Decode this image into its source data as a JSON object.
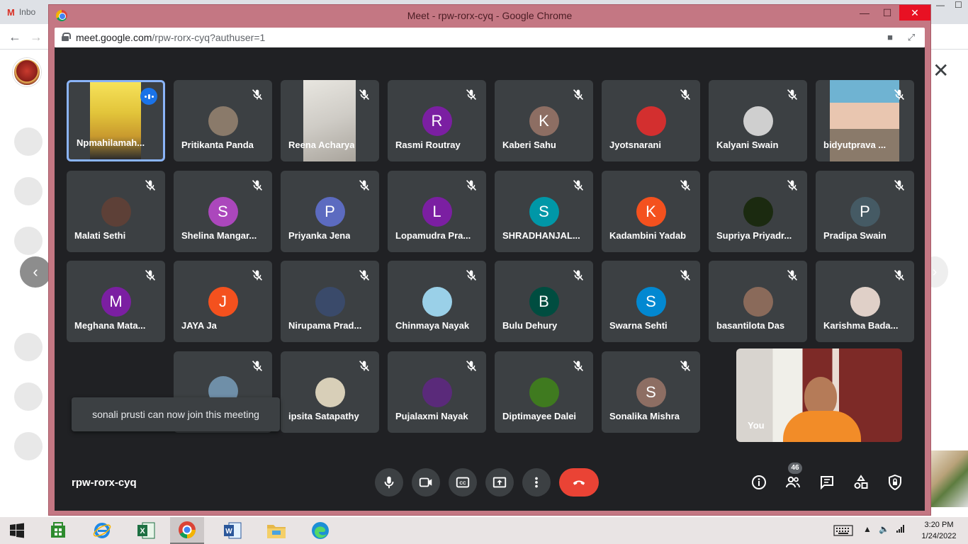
{
  "background_tab": {
    "label": "Inbo"
  },
  "window": {
    "title": "Meet - rpw-rorx-cyq - Google Chrome"
  },
  "address": {
    "host": "meet.google.com",
    "path": "/rpw-rorx-cyq?authuser=1"
  },
  "meeting": {
    "code": "rpw-rorx-cyq",
    "participant_count": "46"
  },
  "toast": {
    "text": "sonali prusti can now join this meeting"
  },
  "self_view": {
    "label": "You"
  },
  "participants": [
    {
      "name": "Npmahilamah...",
      "type": "video",
      "speaking": true
    },
    {
      "name": "Pritikanta Panda",
      "type": "photo",
      "color": "#8a7a6a"
    },
    {
      "name": "Reena Acharya",
      "type": "video"
    },
    {
      "name": "Rasmi Routray",
      "type": "letter",
      "initial": "R",
      "color": "#7b1fa2"
    },
    {
      "name": "Kaberi Sahu",
      "type": "letter",
      "initial": "K",
      "color": "#8d6e63"
    },
    {
      "name": "Jyotsnarani",
      "type": "photo",
      "color": "#d32f2f"
    },
    {
      "name": "Kalyani Swain",
      "type": "photo",
      "color": "#cfcfcf"
    },
    {
      "name": "bidyutprava ...",
      "type": "video"
    },
    {
      "name": "Malati Sethi",
      "type": "photo",
      "color": "#5d4037"
    },
    {
      "name": "Shelina Mangar...",
      "type": "letter",
      "initial": "S",
      "color": "#ab47bc"
    },
    {
      "name": "Priyanka Jena",
      "type": "letter",
      "initial": "P",
      "color": "#5c6bc0"
    },
    {
      "name": "Lopamudra Pra...",
      "type": "letter",
      "initial": "L",
      "color": "#7b1fa2"
    },
    {
      "name": "SHRADHANJAL...",
      "type": "letter",
      "initial": "S",
      "color": "#0097a7"
    },
    {
      "name": "Kadambini Yadab",
      "type": "letter",
      "initial": "K",
      "color": "#f4511e"
    },
    {
      "name": "Supriya Priyadr...",
      "type": "photo",
      "color": "#1b2a10"
    },
    {
      "name": "Pradipa Swain",
      "type": "letter",
      "initial": "P",
      "color": "#455a64"
    },
    {
      "name": "Meghana Mata...",
      "type": "letter",
      "initial": "M",
      "color": "#7b1fa2"
    },
    {
      "name": "JAYA Ja",
      "type": "letter",
      "initial": "J",
      "color": "#f4511e"
    },
    {
      "name": "Nirupama Prad...",
      "type": "photo",
      "color": "#3a4a6a"
    },
    {
      "name": "Chinmaya Nayak",
      "type": "photo",
      "color": "#9ad0e8"
    },
    {
      "name": "Bulu Dehury",
      "type": "letter",
      "initial": "B",
      "color": "#004d40"
    },
    {
      "name": "Swarna Sehti",
      "type": "letter",
      "initial": "S",
      "color": "#0288d1"
    },
    {
      "name": "basantilota Das",
      "type": "photo",
      "color": "#8a6a5a"
    },
    {
      "name": "Karishma Bada...",
      "type": "photo",
      "color": "#e0d0c8"
    },
    {
      "name": "",
      "type": "photo",
      "color": "#6f8fa8"
    },
    {
      "name": "ipsita Satapathy",
      "type": "photo",
      "color": "#d8cfb8"
    },
    {
      "name": "Pujalaxmi Nayak",
      "type": "photo",
      "color": "#5a2a7a"
    },
    {
      "name": "Diptimayee Dalei",
      "type": "photo",
      "color": "#3f7a1f"
    },
    {
      "name": "Sonalika Mishra",
      "type": "letter",
      "initial": "S",
      "color": "#8d6e63"
    }
  ],
  "controls": {
    "mic": "microphone-icon",
    "camera": "camera-icon",
    "captions": "captions-icon",
    "present": "present-icon",
    "more": "more-options-icon",
    "hangup": "hang-up-icon"
  },
  "right_controls": [
    "info-icon",
    "people-icon",
    "chat-icon",
    "activities-icon",
    "host-controls-icon"
  ],
  "taskbar": {
    "time": "3:20 PM",
    "date": "1/24/2022"
  }
}
